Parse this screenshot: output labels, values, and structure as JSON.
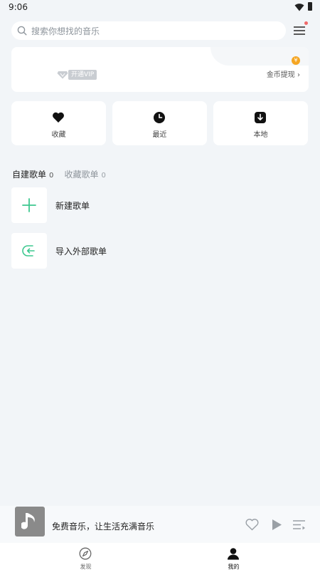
{
  "status_bar": {
    "time": "9:06"
  },
  "search": {
    "placeholder": "搜索你想找的音乐"
  },
  "vip_card": {
    "vip_label": "开通VIP",
    "coin_symbol": "¥",
    "coin_withdraw": "金币提现 ›"
  },
  "quick_actions": [
    {
      "label": "收藏",
      "icon": "heart-icon"
    },
    {
      "label": "最近",
      "icon": "clock-icon"
    },
    {
      "label": "本地",
      "icon": "download-icon"
    }
  ],
  "playlist_tabs": [
    {
      "label": "自建歌单",
      "count": "0"
    },
    {
      "label": "收藏歌单",
      "count": "0"
    }
  ],
  "playlist_actions": [
    {
      "label": "新建歌单",
      "icon": "plus-icon"
    },
    {
      "label": "导入外部歌单",
      "icon": "import-icon"
    }
  ],
  "player": {
    "title": "免费音乐，让生活充满音乐"
  },
  "bottom_nav": [
    {
      "label": "发现",
      "icon": "compass-icon"
    },
    {
      "label": "我的",
      "icon": "user-icon"
    }
  ],
  "colors": {
    "background": "#f2f5f8",
    "accent_green": "#3dc88f",
    "coin_orange": "#f5a623",
    "badge_red": "#f06a6a"
  }
}
